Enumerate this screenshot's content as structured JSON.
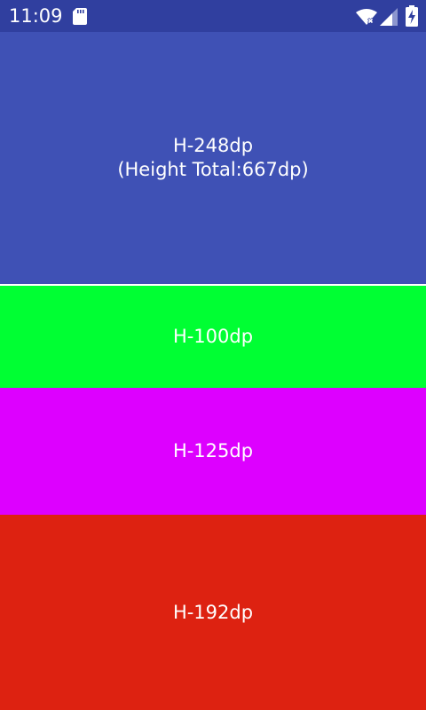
{
  "status_bar": {
    "time": "11:09",
    "icons": [
      "sd-card-icon",
      "wifi-icon",
      "signal-icon",
      "battery-charging-icon"
    ],
    "background": "#303f9f"
  },
  "blocks": [
    {
      "label": "H-248dp",
      "sublabel": "(Height Total:667dp)",
      "color": "#3f51b5"
    },
    {
      "label": "H-100dp",
      "color": "#00ff33"
    },
    {
      "label": "H-125dp",
      "color": "#dd00ff"
    },
    {
      "label": "H-192dp",
      "color": "#dd2211"
    }
  ]
}
